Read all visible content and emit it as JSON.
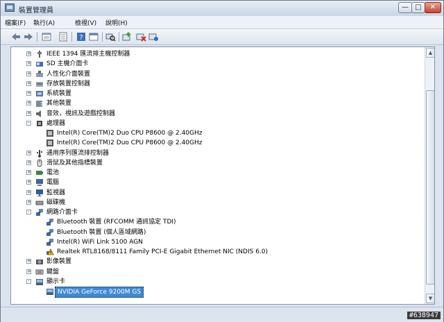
{
  "window": {
    "title": "裝置管理員"
  },
  "controls": {
    "minimize": "—",
    "maximize": "□",
    "close": "✕"
  },
  "menu": [
    "檔案(F)",
    "執行(A)",
    "檢視(V)",
    "說明(H)"
  ],
  "toolbar": [
    "back-icon",
    "forward-icon",
    "properties-list-icon",
    "properties-icon",
    "help-icon",
    "refresh-icon",
    "scan-icon",
    "update-driver-icon",
    "disable-icon",
    "uninstall-icon"
  ],
  "tree": [
    {
      "label": "IEEE 1394 匯流排主機控制器",
      "icon": "firewire-icon",
      "level": 0,
      "expander": "+"
    },
    {
      "label": "SD 主機介面卡",
      "icon": "sd-host-icon",
      "level": 0,
      "expander": "+"
    },
    {
      "label": "人性化介面裝置",
      "icon": "hid-icon",
      "level": 0,
      "expander": "+"
    },
    {
      "label": "存放裝置控制器",
      "icon": "storage-controller-icon",
      "level": 0,
      "expander": "+"
    },
    {
      "label": "系統裝置",
      "icon": "system-device-icon",
      "level": 0,
      "expander": "+"
    },
    {
      "label": "其他裝置",
      "icon": "other-device-icon",
      "level": 0,
      "expander": "+"
    },
    {
      "label": "音效，視訊及遊戲控制器",
      "icon": "sound-icon",
      "level": 0,
      "expander": "+"
    },
    {
      "label": "處理器",
      "icon": "processor-icon",
      "level": 0,
      "expander": "-"
    },
    {
      "label": "Intel(R) Core(TM)2 Duo CPU     P8600  @ 2.40GHz",
      "icon": "cpu-icon",
      "level": 1,
      "expander": ""
    },
    {
      "label": "Intel(R) Core(TM)2 Duo CPU     P8600  @ 2.40GHz",
      "icon": "cpu-icon",
      "level": 1,
      "expander": ""
    },
    {
      "label": "通用序列匯流排控制器",
      "icon": "usb-icon",
      "level": 0,
      "expander": "+"
    },
    {
      "label": "滑鼠及其他指標裝置",
      "icon": "mouse-icon",
      "level": 0,
      "expander": "+"
    },
    {
      "label": "電池",
      "icon": "battery-icon",
      "level": 0,
      "expander": "+"
    },
    {
      "label": "電腦",
      "icon": "computer-icon",
      "level": 0,
      "expander": "+"
    },
    {
      "label": "監視器",
      "icon": "monitor-icon",
      "level": 0,
      "expander": "+"
    },
    {
      "label": "磁碟機",
      "icon": "disk-drive-icon",
      "level": 0,
      "expander": "+"
    },
    {
      "label": "網路介面卡",
      "icon": "network-adapter-icon",
      "level": 0,
      "expander": "-"
    },
    {
      "label": "Bluetooth 裝置 (RFCOMM 通訊協定 TDI)",
      "icon": "network-adapter-icon",
      "level": 1,
      "expander": ""
    },
    {
      "label": "Bluetooth 裝置 (個人區域網路)",
      "icon": "network-adapter-icon",
      "level": 1,
      "expander": ""
    },
    {
      "label": "Intel(R) WiFi Link 5100 AGN",
      "icon": "network-adapter-icon",
      "level": 1,
      "expander": ""
    },
    {
      "label": "Realtek RTL8168/8111 Family PCI-E Gigabit Ethernet NIC (NDIS 6.0)",
      "icon": "warning-icon",
      "level": 1,
      "expander": ""
    },
    {
      "label": "影像裝置",
      "icon": "imaging-device-icon",
      "level": 0,
      "expander": "+"
    },
    {
      "label": "鍵盤",
      "icon": "keyboard-icon",
      "level": 0,
      "expander": "+"
    },
    {
      "label": "顯示卡",
      "icon": "display-adapter-icon",
      "level": 0,
      "expander": "-"
    },
    {
      "label": "NVIDIA GeForce 9200M GS",
      "icon": "display-adapter-icon",
      "level": 1,
      "expander": "",
      "selected": true
    }
  ],
  "watermark": "#638947"
}
